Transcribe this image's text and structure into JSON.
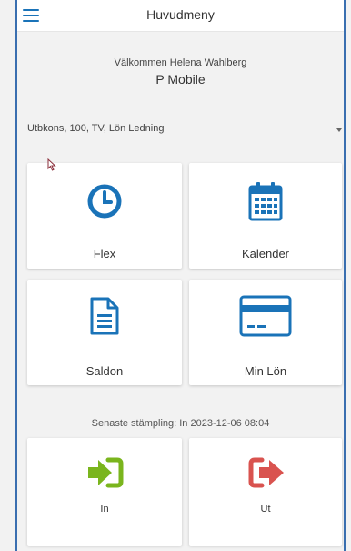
{
  "header": {
    "title": "Huvudmeny",
    "menu_icon": "hamburger-icon"
  },
  "welcome": {
    "greeting": "Välkommen Helena Wahlberg",
    "app_name": "P Mobile"
  },
  "selector": {
    "value": "Utbkons, 100, TV, Lön Ledning"
  },
  "tiles": {
    "flex": {
      "label": "Flex",
      "icon": "clock-icon"
    },
    "kalender": {
      "label": "Kalender",
      "icon": "calendar-icon"
    },
    "saldon": {
      "label": "Saldon",
      "icon": "document-icon"
    },
    "minlon": {
      "label": "Min Lön",
      "icon": "credit-card-icon"
    }
  },
  "last_stamp": {
    "text": "Senaste stämpling: In 2023-12-06 08:04"
  },
  "stamp": {
    "in": {
      "label": "In",
      "icon": "sign-in-icon",
      "color": "#7ab51d"
    },
    "out": {
      "label": "Ut",
      "icon": "sign-out-icon",
      "color": "#d9534f"
    }
  },
  "colors": {
    "accent": "#1a73b8",
    "frame": "#3a6fb0"
  }
}
